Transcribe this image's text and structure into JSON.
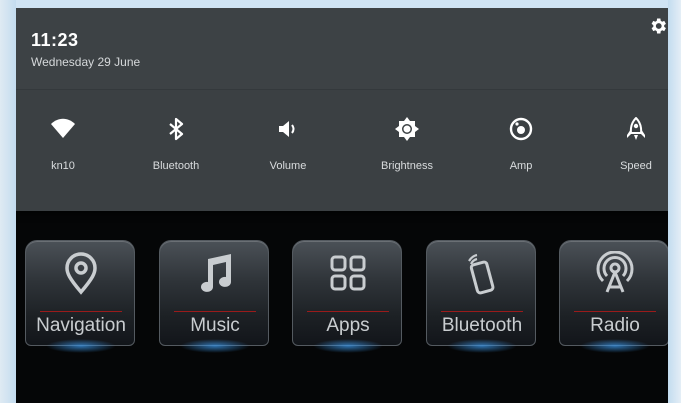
{
  "status": {
    "time": "11:23",
    "date": "Wednesday 29 June"
  },
  "quick_settings": [
    {
      "label": "kn10",
      "icon": "wifi-icon"
    },
    {
      "label": "Bluetooth",
      "icon": "bluetooth-icon"
    },
    {
      "label": "Volume",
      "icon": "volume-icon"
    },
    {
      "label": "Brightness",
      "icon": "brightness-icon"
    },
    {
      "label": "Amp",
      "icon": "speaker-icon"
    },
    {
      "label": "Speed",
      "icon": "rocket-icon"
    }
  ],
  "apps": [
    {
      "label": "Navigation",
      "icon": "location-pin-icon"
    },
    {
      "label": "Music",
      "icon": "music-note-icon"
    },
    {
      "label": "Apps",
      "icon": "grid-icon"
    },
    {
      "label": "Bluetooth",
      "icon": "phone-icon"
    },
    {
      "label": "Radio",
      "icon": "radio-tower-icon"
    }
  ],
  "colors": {
    "shade": "#3b4043",
    "background": "#050607",
    "accent_line": "#9a1b1b",
    "glow": "#3c96e6"
  }
}
